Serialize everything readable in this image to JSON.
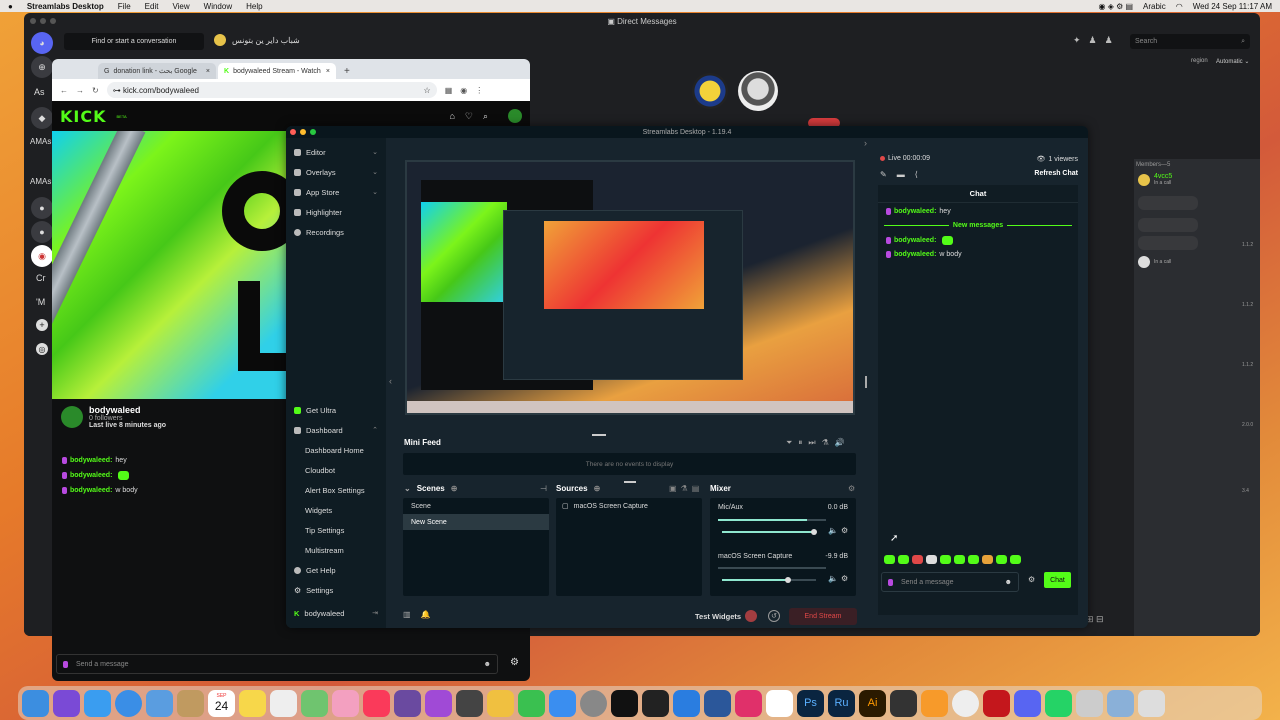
{
  "menubar": {
    "apple": "",
    "app": "Streamlabs Desktop",
    "items": [
      "File",
      "Edit",
      "View",
      "Window",
      "Help"
    ],
    "lang": "Arabic",
    "datetime": "Wed 24 Sep  11:17 AM"
  },
  "discord": {
    "title": "Direct Messages",
    "find": "Find or start a conversation",
    "dm_user": "شباب داير ين بتونس",
    "search_placeholder": "Search",
    "left_labels": [
      "As",
      "AMAs",
      "AMAs",
      "Cr",
      "'M"
    ],
    "region_label": "region",
    "region_value": "Automatic",
    "members_header": "Members—5",
    "members": [
      {
        "name": "4vcc5",
        "status": "In a call"
      },
      {
        "name": "",
        "status": "In a call"
      }
    ],
    "side_versions": [
      "1.1.2",
      "1.1.2",
      "1.1.2",
      "2.0.0",
      "3.4"
    ]
  },
  "chrome": {
    "tabs": [
      {
        "label": "donation link - بحث Google"
      },
      {
        "label": "bodywaleed Stream - Watch"
      }
    ],
    "url": "kick.com/bodywaleed",
    "logo": "KICK",
    "logo_beta": "BETA",
    "channel": {
      "name": "bodywaleed",
      "followers": "0 followers",
      "last_live": "Last live 8 minutes ago"
    },
    "chat": [
      {
        "user": "bodywaleed:",
        "text": "hey"
      },
      {
        "user": "bodywaleed:",
        "text": ""
      },
      {
        "user": "bodywaleed:",
        "text": "w body"
      }
    ],
    "send_placeholder": "Send a message"
  },
  "streamlabs": {
    "title": "Streamlabs Desktop - 1.19.4",
    "nav_top": [
      {
        "label": "Editor",
        "chev": "⌄"
      },
      {
        "label": "Overlays",
        "chev": "⌄"
      },
      {
        "label": "App Store",
        "chev": "⌄"
      },
      {
        "label": "Highlighter",
        "chev": ""
      },
      {
        "label": "Recordings",
        "chev": ""
      }
    ],
    "nav_bottom": {
      "get_ultra": "Get Ultra",
      "dashboard": "Dashboard",
      "dashboard_items": [
        "Dashboard Home",
        "Cloudbot",
        "Alert Box Settings",
        "Widgets",
        "Tip Settings",
        "Multistream"
      ],
      "get_help": "Get Help",
      "settings": "Settings",
      "user": "bodywaleed"
    },
    "minifeed": {
      "title": "Mini Feed",
      "empty": "There are no events to display"
    },
    "scenes": {
      "title": "Scenes",
      "items": [
        "Scene",
        "New Scene"
      ],
      "selected": 1
    },
    "sources": {
      "title": "Sources",
      "items": [
        "macOS Screen Capture"
      ]
    },
    "mixer": {
      "title": "Mixer",
      "channels": [
        {
          "name": "Mic/Aux",
          "db": "0.0 dB",
          "level": 0.82,
          "volume": 0.98
        },
        {
          "name": "macOS Screen Capture",
          "db": "-9.9 dB",
          "level": 0.0,
          "volume": 0.7
        }
      ]
    },
    "footer": {
      "test_widgets": "Test Widgets",
      "end_stream": "End Stream"
    },
    "live": {
      "status": "Live 00:00:09",
      "viewers": "1 viewers",
      "refresh": "Refresh Chat"
    },
    "chat": {
      "title": "Chat",
      "new_messages": "New messages",
      "messages": [
        {
          "user": "bodywaleed:",
          "text": "hey"
        },
        {
          "user": "bodywaleed:",
          "text": ""
        },
        {
          "user": "bodywaleed:",
          "text": "w body"
        }
      ],
      "placeholder": "Send a message",
      "send": "Chat"
    }
  },
  "dock": {
    "apps": [
      "finder",
      "launchpad",
      "mail",
      "safari",
      "apps",
      "books",
      "calendar",
      "notes",
      "freeform",
      "maps",
      "photos",
      "music",
      "imovie",
      "podcasts",
      "calculator",
      "pencil",
      "numbers",
      "keynote",
      "system-settings",
      "terminal",
      "appletv",
      "onedrive",
      "word",
      "creative-cloud",
      "reminders",
      "photoshop",
      "rush",
      "illustrator",
      "davinci",
      "books2",
      "chrome",
      "acrobat",
      "discord",
      "whatsapp",
      "preview",
      "folder",
      "trash"
    ],
    "calendar_month": "SEP",
    "calendar_day": "24"
  },
  "colors": {
    "kick_green": "#53fc18",
    "sl_bg": "#17242d",
    "sl_panel": "#09161d",
    "end_stream": "#e04848"
  }
}
